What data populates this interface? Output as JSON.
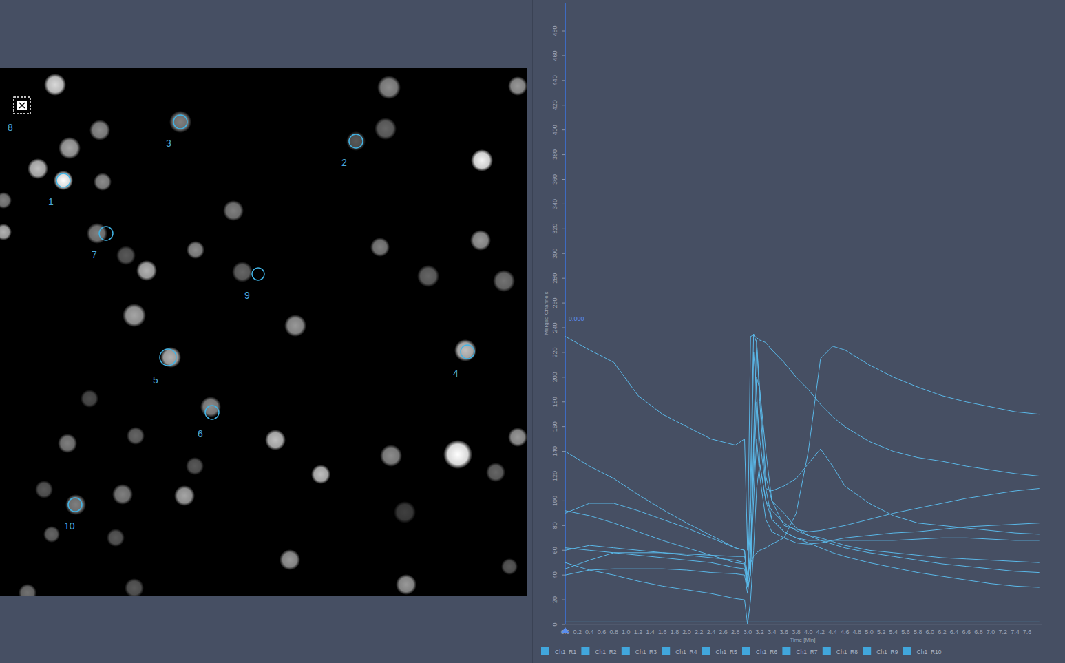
{
  "image": {
    "rois": [
      {
        "label": "1",
        "kind": "circle"
      },
      {
        "label": "2",
        "kind": "circle"
      },
      {
        "label": "3",
        "kind": "circle"
      },
      {
        "label": "4",
        "kind": "circle"
      },
      {
        "label": "5",
        "kind": "circle"
      },
      {
        "label": "6",
        "kind": "circle"
      },
      {
        "label": "7",
        "kind": "circle"
      },
      {
        "label": "8",
        "kind": "marker"
      },
      {
        "label": "9",
        "kind": "circle"
      },
      {
        "label": "10",
        "kind": "circle"
      }
    ]
  },
  "chart": {
    "y_axis": {
      "title": "Merged Channels",
      "ticks": [
        "0",
        "20",
        "40",
        "60",
        "80",
        "100",
        "120",
        "140",
        "160",
        "180",
        "200",
        "220",
        "240",
        "260",
        "280",
        "300",
        "320",
        "340",
        "360",
        "380",
        "400",
        "420",
        "440",
        "460",
        "480"
      ]
    },
    "x_axis": {
      "title": "Time [Min]",
      "ticks": [
        "0.0",
        "0.2",
        "0.4",
        "0.6",
        "0.8",
        "1.0",
        "1.2",
        "1.4",
        "1.6",
        "1.8",
        "2.0",
        "2.2",
        "2.4",
        "2.6",
        "2.8",
        "3.0",
        "3.2",
        "3.4",
        "3.6",
        "3.8",
        "4.0",
        "4.2",
        "4.4",
        "4.6",
        "4.8",
        "5.0",
        "5.2",
        "5.4",
        "5.6",
        "5.8",
        "6.0",
        "6.2",
        "6.4",
        "6.6",
        "6.8",
        "7.0",
        "7.2",
        "7.4",
        "7.6"
      ]
    },
    "cursor": {
      "label": "0.000"
    },
    "times": [
      0,
      0.4,
      0.8,
      1.2,
      1.6,
      2.0,
      2.4,
      2.8,
      2.95,
      3.0,
      3.05,
      3.1,
      3.15,
      3.2,
      3.3,
      3.4,
      3.6,
      3.8,
      4.0,
      4.2,
      4.4,
      4.6,
      5.0,
      5.4,
      5.8,
      6.2,
      6.6,
      7.0,
      7.4,
      7.8
    ],
    "series": [
      {
        "name": "Ch1_R1",
        "values": [
          233,
          222,
          212,
          185,
          170,
          160,
          150,
          145,
          150,
          60,
          233,
          234,
          232,
          230,
          228,
          222,
          212,
          200,
          190,
          178,
          168,
          160,
          148,
          140,
          135,
          132,
          128,
          125,
          122,
          120
        ]
      },
      {
        "name": "Ch1_R2",
        "values": [
          140,
          128,
          118,
          105,
          93,
          82,
          72,
          62,
          60,
          30,
          40,
          150,
          230,
          180,
          110,
          85,
          75,
          70,
          66,
          62,
          58,
          55,
          50,
          46,
          42,
          39,
          36,
          33,
          31,
          30
        ]
      },
      {
        "name": "Ch1_R3",
        "values": [
          90,
          98,
          98,
          92,
          85,
          78,
          70,
          62,
          60,
          35,
          60,
          120,
          180,
          150,
          110,
          108,
          112,
          118,
          130,
          142,
          128,
          112,
          98,
          88,
          82,
          80,
          78,
          76,
          74,
          73
        ]
      },
      {
        "name": "Ch1_R4",
        "values": [
          60,
          64,
          62,
          60,
          58,
          57,
          56,
          55,
          55,
          40,
          50,
          55,
          58,
          60,
          62,
          65,
          70,
          90,
          140,
          215,
          225,
          222,
          210,
          200,
          192,
          185,
          180,
          176,
          172,
          170
        ]
      },
      {
        "name": "Ch1_R5",
        "values": [
          92,
          88,
          82,
          75,
          68,
          62,
          56,
          50,
          49,
          30,
          90,
          220,
          190,
          130,
          100,
          92,
          82,
          76,
          72,
          68,
          65,
          62,
          58,
          55,
          52,
          49,
          47,
          45,
          43,
          42
        ]
      },
      {
        "name": "Ch1_R6",
        "values": [
          45,
          52,
          58,
          58,
          58,
          56,
          54,
          52,
          50,
          35,
          120,
          235,
          228,
          190,
          140,
          100,
          80,
          77,
          75,
          76,
          78,
          80,
          85,
          90,
          94,
          98,
          102,
          105,
          108,
          110
        ]
      },
      {
        "name": "Ch1_R7",
        "values": [
          62,
          60,
          58,
          56,
          54,
          52,
          50,
          46,
          45,
          30,
          60,
          140,
          200,
          190,
          120,
          100,
          90,
          78,
          72,
          70,
          67,
          64,
          60,
          58,
          56,
          54,
          53,
          52,
          51,
          50
        ]
      },
      {
        "name": "Ch1_R8",
        "values": [
          2,
          2,
          2,
          2,
          2,
          2,
          2,
          2,
          2,
          2,
          2,
          2,
          2,
          2,
          2,
          2,
          2,
          2,
          2,
          2,
          2,
          2,
          2,
          2,
          2,
          2,
          2,
          2,
          2,
          2
        ]
      },
      {
        "name": "Ch1_R9",
        "values": [
          40,
          44,
          45,
          45,
          45,
          44,
          42,
          41,
          40,
          25,
          45,
          100,
          150,
          120,
          85,
          75,
          70,
          66,
          65,
          66,
          68,
          70,
          72,
          74,
          75,
          77,
          79,
          80,
          81,
          82
        ]
      },
      {
        "name": "Ch1_R10",
        "values": [
          50,
          44,
          40,
          35,
          31,
          28,
          25,
          21,
          20,
          0,
          20,
          60,
          110,
          130,
          100,
          85,
          75,
          70,
          68,
          68,
          68,
          68,
          68,
          68,
          69,
          70,
          70,
          69,
          68,
          68
        ]
      }
    ]
  }
}
